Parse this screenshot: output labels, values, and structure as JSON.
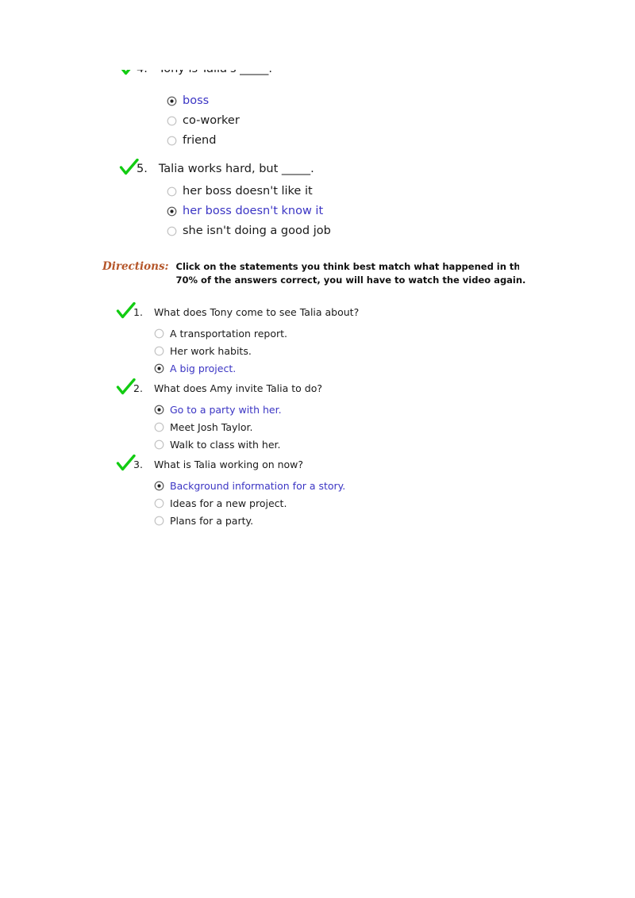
{
  "page": {
    "background_color": "#ffffff",
    "selected_answer_color": "#3b35c4",
    "checkmark_color": "#12cc12",
    "directions_label_color": "#b5562a",
    "body_text_color": "#1a1a1a"
  },
  "top_section": {
    "questions": [
      {
        "number": "4.",
        "text": "Tony is Talia's _____.",
        "correct": true,
        "clipped": true,
        "options": [
          {
            "label": "boss",
            "selected": true
          },
          {
            "label": "co-worker",
            "selected": false
          },
          {
            "label": "friend",
            "selected": false
          }
        ]
      },
      {
        "number": "5.",
        "text": "Talia works hard, but _____.",
        "correct": true,
        "clipped": false,
        "options": [
          {
            "label": "her boss doesn't like it",
            "selected": false
          },
          {
            "label": "her boss doesn't know it",
            "selected": true
          },
          {
            "label": "she isn't doing a good job",
            "selected": false
          }
        ]
      }
    ]
  },
  "directions": {
    "label": "Directions:",
    "line1": "Click on the statements you think best match what happened in the video you just",
    "line2": "70% of the answers correct, you will have to watch the video again."
  },
  "lower_section": {
    "questions": [
      {
        "number": "1.",
        "text": "What does Tony come to see Talia about?",
        "correct": true,
        "options": [
          {
            "label": "A transportation report.",
            "selected": false
          },
          {
            "label": "Her work habits.",
            "selected": false
          },
          {
            "label": "A big project.",
            "selected": true
          }
        ]
      },
      {
        "number": "2.",
        "text": "What does Amy invite Talia to do?",
        "correct": true,
        "options": [
          {
            "label": "Go to a party with her.",
            "selected": true
          },
          {
            "label": "Meet Josh Taylor.",
            "selected": false
          },
          {
            "label": "Walk to class with her.",
            "selected": false
          }
        ]
      },
      {
        "number": "3.",
        "text": "What is Talia working on now?",
        "correct": true,
        "options": [
          {
            "label": "Background information for a story.",
            "selected": true
          },
          {
            "label": "Ideas for a new project.",
            "selected": false
          },
          {
            "label": "Plans for a party.",
            "selected": false
          }
        ]
      }
    ]
  }
}
